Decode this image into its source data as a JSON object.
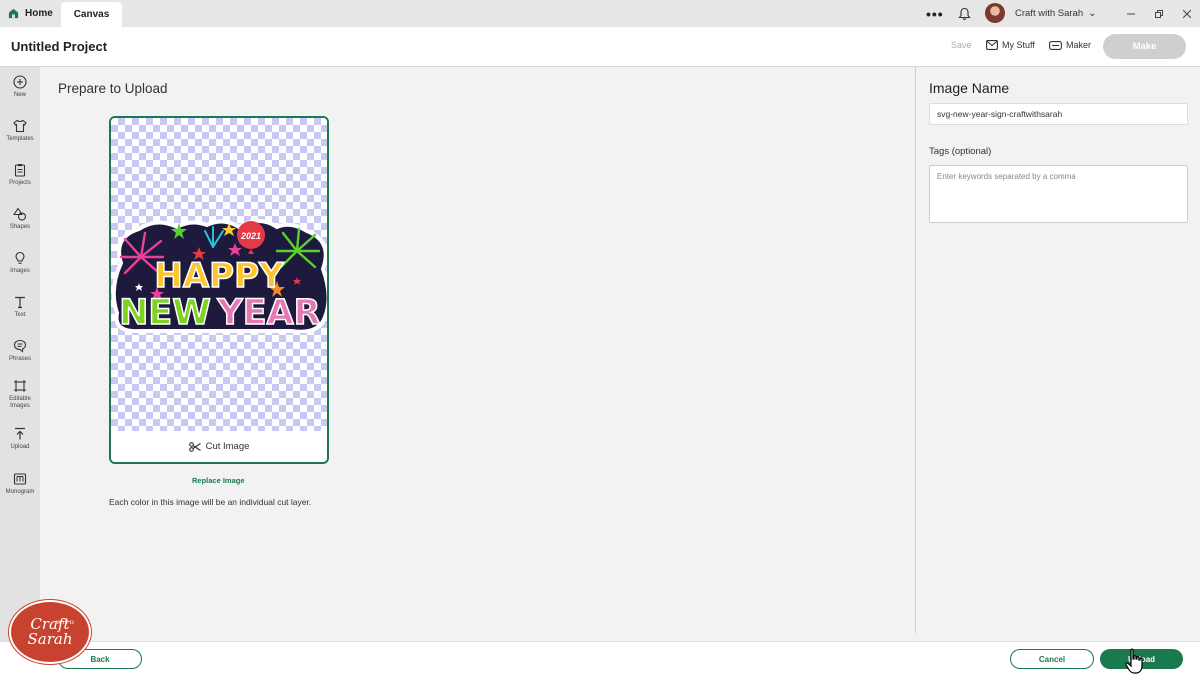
{
  "titlebar": {
    "home_tab": "Home",
    "canvas_tab": "Canvas",
    "more_label": "•••",
    "account_name": "Craft with Sarah"
  },
  "project": {
    "title": "Untitled Project",
    "save_label": "Save",
    "mystuff_label": "My Stuff",
    "maker_label": "Maker",
    "make_label": "Make"
  },
  "sidebar": {
    "items": [
      {
        "label": "New",
        "icon": "plus-circle-icon"
      },
      {
        "label": "Templates",
        "icon": "shirt-icon"
      },
      {
        "label": "Projects",
        "icon": "clipboard-icon"
      },
      {
        "label": "Shapes",
        "icon": "shapes-icon"
      },
      {
        "label": "Images",
        "icon": "lightbulb-icon"
      },
      {
        "label": "Text",
        "icon": "text-icon"
      },
      {
        "label": "Phrases",
        "icon": "speech-bubble-icon"
      },
      {
        "label": "Editable Images",
        "icon": "editable-image-icon"
      },
      {
        "label": "Upload",
        "icon": "upload-icon"
      },
      {
        "label": "Monogram",
        "icon": "monogram-icon"
      }
    ]
  },
  "main": {
    "title": "Prepare to Upload",
    "cut_image_label": "Cut Image",
    "replace_label": "Replace Image",
    "note": "Each color in this image will be an individual cut layer.",
    "artwork": {
      "year": "2021",
      "line1": "HAPPY",
      "line2a": "NEW",
      "line2b": "YEAR"
    }
  },
  "right_panel": {
    "image_name_title": "Image Name",
    "image_name_value": "svg-new-year-sign-craftwithsarah",
    "tags_label": "Tags (optional)",
    "tags_placeholder": "Enter keywords separated by a comma"
  },
  "bottom": {
    "back_label": "Back",
    "cancel_label": "Cancel",
    "upload_label": "Upload"
  },
  "logo": {
    "line1": "Craft",
    "with": "WITH",
    "line2": "Sarah"
  },
  "colors": {
    "accent": "#1a7a4e",
    "make_disabled": "#cfcfcf",
    "logo": "#c8432f"
  }
}
